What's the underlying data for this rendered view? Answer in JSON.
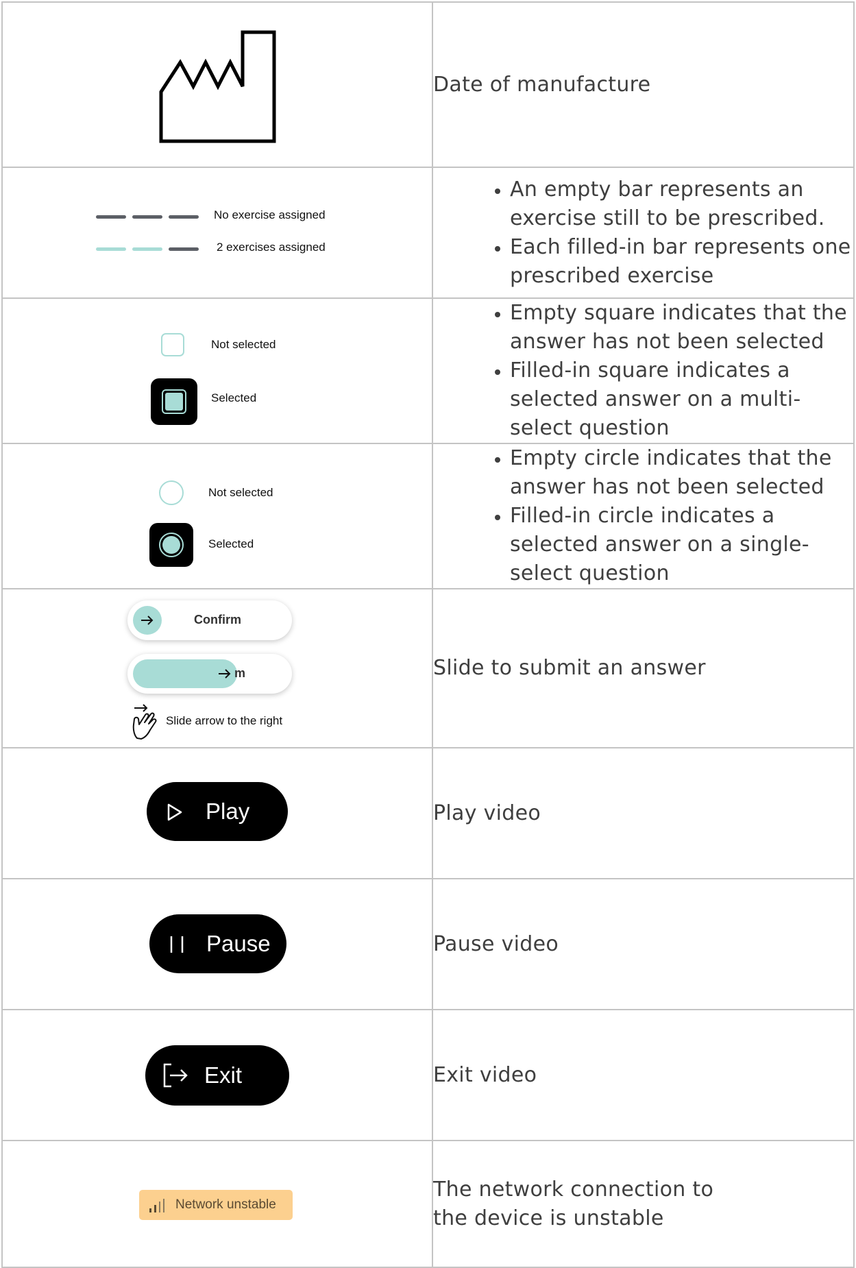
{
  "colors": {
    "accent": "#a8dcd6",
    "accent_dark": "#8fd3cb",
    "bar_gray": "#5c5f66",
    "badge_bg": "#fcd08f",
    "badge_text": "#5a4a32"
  },
  "rows": {
    "manufacture": {
      "icon": "factory-icon",
      "text": "Date of manufacture"
    },
    "progress": {
      "none_label": "No exercise assigned",
      "two_label": "2 exercises assigned",
      "bullets": [
        "An empty bar represents an exercise still to be prescribed.",
        "Each filled-in bar represents one prescribed exercise"
      ]
    },
    "checkbox": {
      "not_selected": "Not selected",
      "selected": "Selected",
      "bullets": [
        "Empty square indicates that the answer has not been selected",
        "Filled-in square indicates a selected answer on a multi-select question"
      ]
    },
    "radio": {
      "not_selected": "Not selected",
      "selected": "Selected",
      "bullets": [
        "Empty circle indicates that the answer has not been selected",
        "Filled-in circle indicates a selected answer on a single-select question"
      ]
    },
    "slide": {
      "confirm": "Confirm",
      "partial": "m",
      "hint": "Slide arrow to the right",
      "text": "Slide to submit an answer"
    },
    "play": {
      "label": "Play",
      "icon": "play-icon",
      "text": "Play video"
    },
    "pause": {
      "label": "Pause",
      "icon": "pause-icon",
      "text": "Pause video"
    },
    "exit": {
      "label": "Exit",
      "icon": "exit-icon",
      "text": "Exit video"
    },
    "network": {
      "label": "Network unstable",
      "icon": "signal-icon",
      "text": "The network connection to the device is unstable"
    }
  }
}
